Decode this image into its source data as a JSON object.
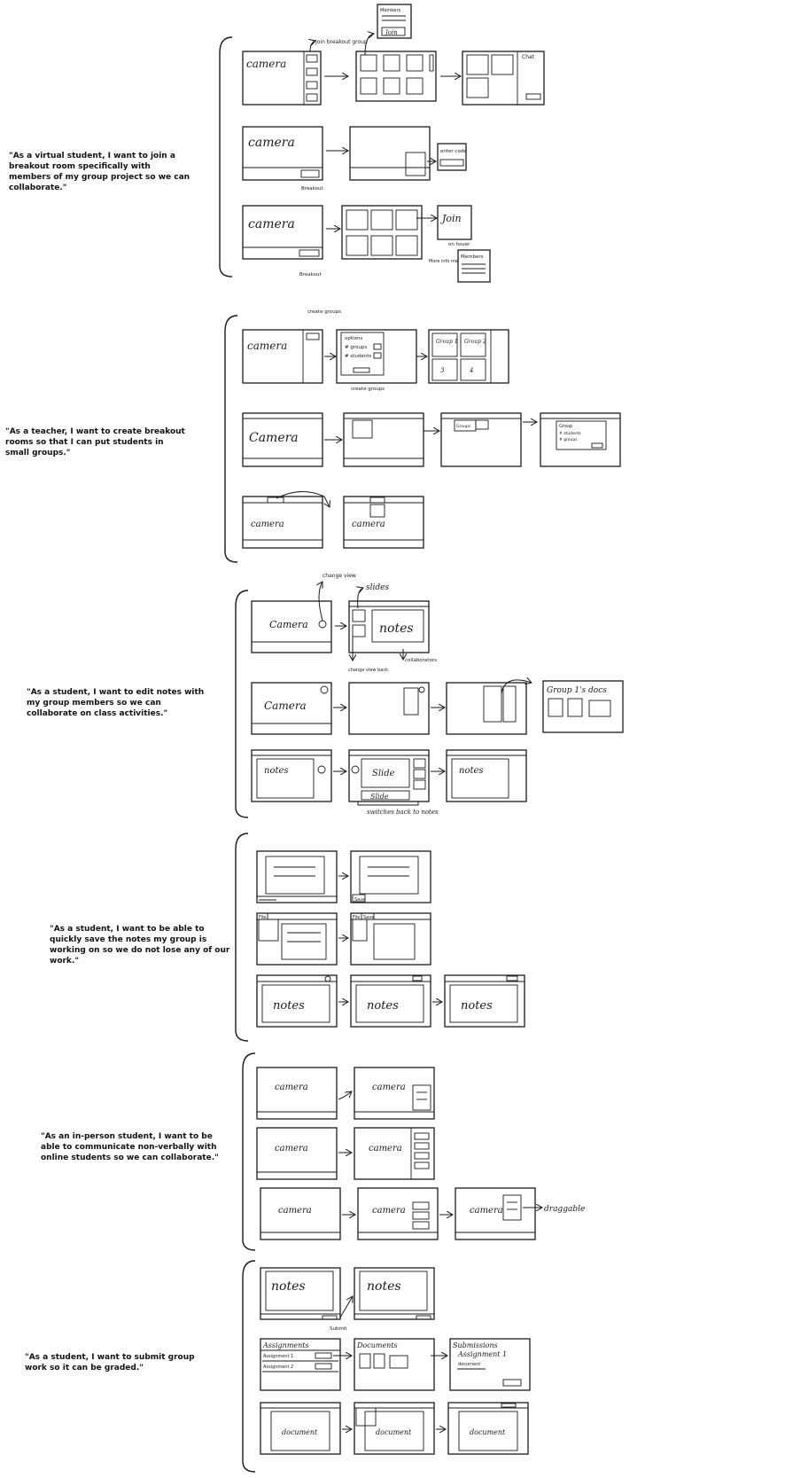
{
  "stories": [
    "\"As a virtual student, I want to join a breakout room specifically with members of my group project so we can collaborate.\"",
    "\"As a teacher, I want to create breakout rooms so that I can put students in small groups.\"",
    "\"As a student, I want to edit notes with my group members so we can collaborate on class activities.\"",
    "\"As a student, I want to be able to quickly save the notes my group is working on so we do not lose any of our work.\"",
    "\"As an in-person student, I want to be able to communicate non-verbally with online students so we can collaborate.\"",
    "\"As a student, I want to submit group work so it can be graded.\""
  ],
  "labels": {
    "camera": "Camera",
    "camera_lower": "camera",
    "notes": "notes",
    "slide": "Slide",
    "slides": "slides",
    "document": "document",
    "join": "Join",
    "join_breakout": "Join breakout group",
    "members": "Members",
    "chat": "Chat",
    "enter_code": "enter code",
    "breakout": "Breakout",
    "on_hover": "on hover",
    "more_info_members": "More info members",
    "create_groups": "create groups",
    "options": "options",
    "num_groups": "# groups",
    "num_students": "# students",
    "group_1": "Group 1",
    "group_2": "Group 2",
    "group_3": "3",
    "group_4": "4",
    "group_label": "Group",
    "groups_label": "Groups",
    "change_view": "change view",
    "change_view_back": "change view back",
    "collaborators": "collaborators",
    "group_1_docs": "Group 1's docs",
    "switches_back": "switches back to notes",
    "file": "File",
    "save": "Save",
    "save_tab": "Save",
    "draggable": "draggable",
    "submit": "Submit",
    "assignments": "Assignments",
    "assignment_1": "Assignment 1",
    "assignment_2": "Assignment 2",
    "documents": "Documents",
    "submissions": "Submissions",
    "submissions_assignment": "Assignment 1",
    "submissions_doc": "document"
  }
}
